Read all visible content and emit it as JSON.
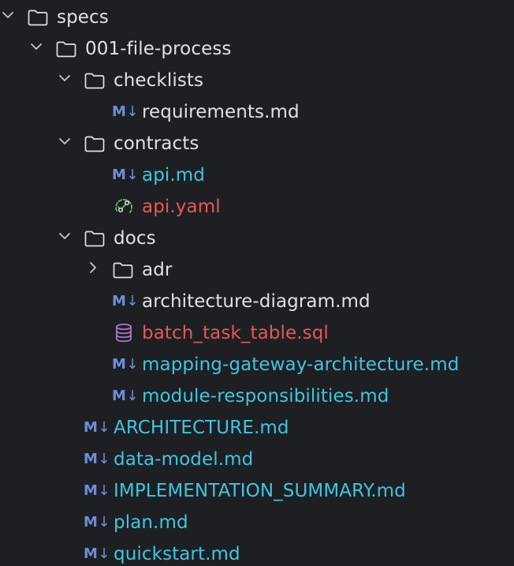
{
  "colors": {
    "background": "#1e1f22",
    "default_text": "#dfe1e5",
    "modified_text": "#3ec6e0",
    "unversioned_text": "#e5575a",
    "md_badge": "#6e8ed9",
    "yaml_icon": "#5fb865",
    "sql_icon": "#b07fd6",
    "folder_icon": "#dfe1e5",
    "chevron": "#c6c8cc"
  },
  "tree": [
    {
      "label": "specs",
      "type": "folder",
      "expanded": true,
      "status": "default"
    },
    {
      "label": "001-file-process",
      "type": "folder",
      "expanded": true,
      "status": "default"
    },
    {
      "label": "checklists",
      "type": "folder",
      "expanded": true,
      "status": "default"
    },
    {
      "label": "requirements.md",
      "type": "markdown",
      "status": "default",
      "badge": "M",
      "badge_arrow": "↓"
    },
    {
      "label": "contracts",
      "type": "folder",
      "expanded": true,
      "status": "default"
    },
    {
      "label": "api.md",
      "type": "markdown",
      "status": "modified",
      "badge": "M",
      "badge_arrow": "↓"
    },
    {
      "label": "api.yaml",
      "type": "openapi",
      "status": "unversioned"
    },
    {
      "label": "docs",
      "type": "folder",
      "expanded": true,
      "status": "default"
    },
    {
      "label": "adr",
      "type": "folder",
      "expanded": false,
      "status": "default"
    },
    {
      "label": "architecture-diagram.md",
      "type": "markdown",
      "status": "default",
      "badge": "M",
      "badge_arrow": "↓"
    },
    {
      "label": "batch_task_table.sql",
      "type": "sql",
      "status": "unversioned"
    },
    {
      "label": "mapping-gateway-architecture.md",
      "type": "markdown",
      "status": "modified",
      "badge": "M",
      "badge_arrow": "↓"
    },
    {
      "label": "module-responsibilities.md",
      "type": "markdown",
      "status": "modified",
      "badge": "M",
      "badge_arrow": "↓"
    },
    {
      "label": "ARCHITECTURE.md",
      "type": "markdown",
      "status": "modified",
      "badge": "M",
      "badge_arrow": "↓"
    },
    {
      "label": "data-model.md",
      "type": "markdown",
      "status": "modified",
      "badge": "M",
      "badge_arrow": "↓"
    },
    {
      "label": "IMPLEMENTATION_SUMMARY.md",
      "type": "markdown",
      "status": "modified",
      "badge": "M",
      "badge_arrow": "↓"
    },
    {
      "label": "plan.md",
      "type": "markdown",
      "status": "modified",
      "badge": "M",
      "badge_arrow": "↓"
    },
    {
      "label": "quickstart.md",
      "type": "markdown",
      "status": "modified",
      "badge": "M",
      "badge_arrow": "↓"
    }
  ]
}
